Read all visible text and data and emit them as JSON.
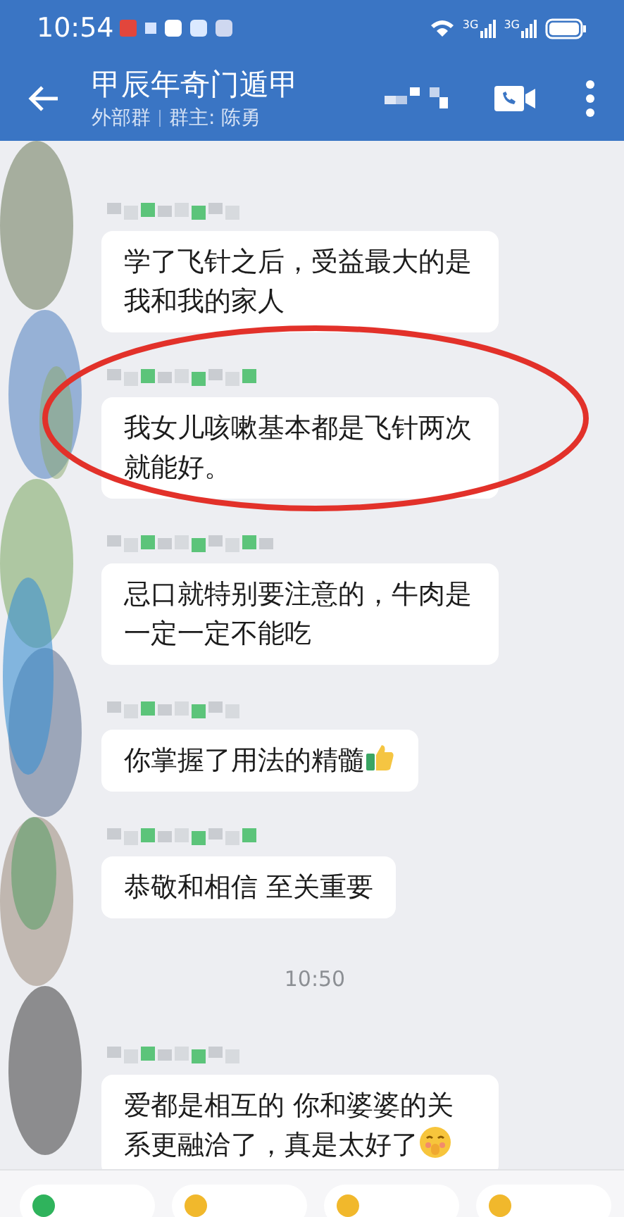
{
  "status_bar": {
    "time": "10:54",
    "network_labels": [
      "3G",
      "3G"
    ]
  },
  "header": {
    "title": "甲辰年奇门遁甲",
    "group_type": "外部群",
    "owner": "群主: 陈勇"
  },
  "messages": [
    {
      "kind": "text",
      "text": "学了飞针之后，受益最大的是我和我的家人",
      "highlighted": false
    },
    {
      "kind": "text",
      "text": "我女儿咳嗽基本都是飞针两次就能好。",
      "highlighted": true
    },
    {
      "kind": "text",
      "text": "忌口就特别要注意的，牛肉是一定一定不能吃",
      "highlighted": false
    },
    {
      "kind": "thumbs",
      "text": "你掌握了用法的精髓",
      "highlighted": false
    },
    {
      "kind": "text",
      "text": "恭敬和相信 至关重要",
      "highlighted": false
    },
    {
      "kind": "time",
      "text": "10:50"
    },
    {
      "kind": "blush",
      "text": "爱都是相互的 你和婆婆的关系更融洽了，真是太好了",
      "highlighted": false
    }
  ]
}
